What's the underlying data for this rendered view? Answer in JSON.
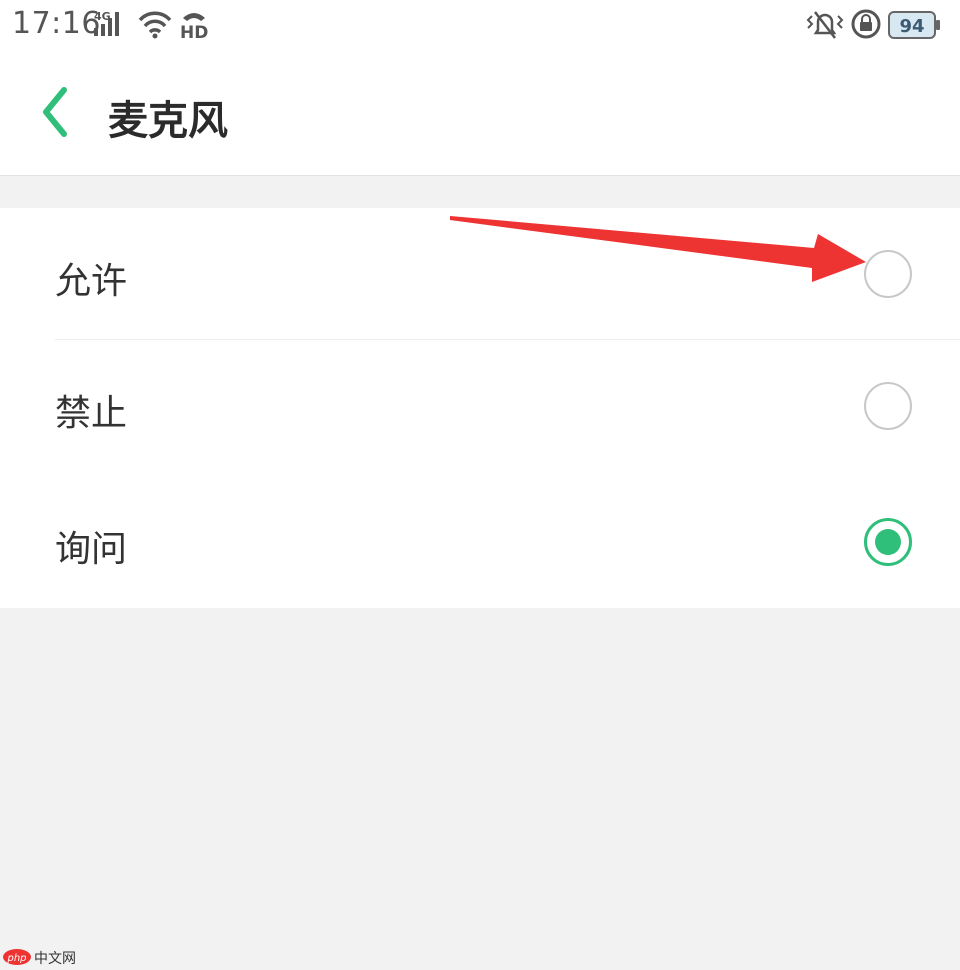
{
  "status_bar": {
    "time": "17:16",
    "network": "4G",
    "hd": "HD",
    "battery": "94"
  },
  "header": {
    "back_icon": "chevron-left-icon",
    "title": "麦克风"
  },
  "options": [
    {
      "label": "允许",
      "checked": false
    },
    {
      "label": "禁止",
      "checked": false
    },
    {
      "label": "询问",
      "checked": true
    }
  ],
  "annotation": {
    "arrow_color": "#ee3333",
    "points_to": "允许"
  },
  "accent_color": "#2fbf7a",
  "watermark": {
    "logo": "php",
    "text": "中文网"
  }
}
